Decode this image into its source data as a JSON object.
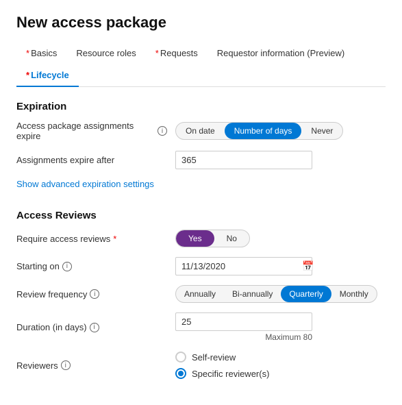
{
  "page": {
    "title": "New access package"
  },
  "nav": {
    "tabs": [
      {
        "id": "basics",
        "label": "Basics",
        "required": true,
        "active": false
      },
      {
        "id": "resource-roles",
        "label": "Resource roles",
        "required": false,
        "active": false
      },
      {
        "id": "requests",
        "label": "Requests",
        "required": true,
        "active": false
      },
      {
        "id": "requestor-info",
        "label": "Requestor information (Preview)",
        "required": false,
        "active": false
      },
      {
        "id": "lifecycle",
        "label": "Lifecycle",
        "required": true,
        "active": true
      }
    ]
  },
  "expiration": {
    "section_title": "Expiration",
    "assignments_expire_label": "Access package assignments expire",
    "on_date_label": "On date",
    "number_of_days_label": "Number of days",
    "never_label": "Never",
    "assignments_expire_after_label": "Assignments expire after",
    "assignments_expire_after_value": "365",
    "show_advanced_link": "Show advanced expiration settings"
  },
  "access_reviews": {
    "section_title": "Access Reviews",
    "require_label": "Require access reviews",
    "yes_label": "Yes",
    "no_label": "No",
    "starting_on_label": "Starting on",
    "starting_on_value": "11/13/2020",
    "review_frequency_label": "Review frequency",
    "freq_annually": "Annually",
    "freq_bi_annually": "Bi-annually",
    "freq_quarterly": "Quarterly",
    "freq_monthly": "Monthly",
    "duration_label": "Duration (in days)",
    "duration_value": "25",
    "max_label": "Maximum 80",
    "reviewers_label": "Reviewers",
    "self_review_label": "Self-review",
    "specific_reviewer_label": "Specific reviewer(s)"
  },
  "icons": {
    "info": "ⓘ",
    "calendar": "📅"
  }
}
